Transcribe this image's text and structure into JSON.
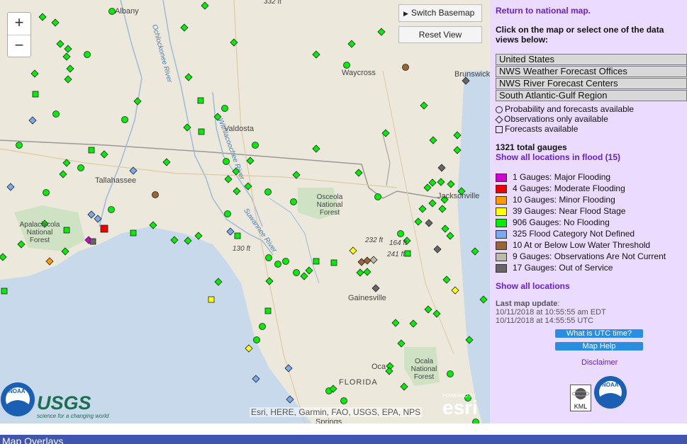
{
  "map": {
    "zoom_in": "+",
    "zoom_out": "−",
    "switch_basemap": "Switch Basemap",
    "reset_view": "Reset View",
    "place_labels": [
      "Albany",
      "Waycross",
      "Brunswick",
      "Valdosta",
      "Tallahassee",
      "Jacksonville",
      "Osceola National Forest",
      "Apalachicola National Forest",
      "Gainesville",
      "Ocala National Forest",
      "FLORIDA",
      "Springs",
      "Oca"
    ],
    "elevation_labels": [
      "332 ft",
      "232 ft",
      "164 ft",
      "241 ft",
      "130 ft"
    ],
    "river_labels": [
      "Ochlockonee River",
      "Withlacoochee River",
      "Suwannee River"
    ],
    "attribution": "Esri, HERE, Garmin, FAO, USGS, EPA, NPS",
    "logos": [
      "NOAA",
      "USGS",
      "science for a changing world",
      "POWERED BY",
      "esri"
    ]
  },
  "panel": {
    "return_link": "Return to national map.",
    "instructions": "Click on the map or select one of the data views below:",
    "views": [
      "United States",
      "NWS Weather Forecast Offices",
      "NWS River Forecast Centers",
      "South Atlantic-Gulf Region"
    ],
    "symbols": [
      {
        "shape": "circle",
        "label": "Probability and forecasts available"
      },
      {
        "shape": "diamond",
        "label": "Observations only available"
      },
      {
        "shape": "square",
        "label": "Forecasts available"
      }
    ],
    "total_gauges": "1321 total gauges",
    "show_flood_link": "Show all locations in flood (15)",
    "legend": [
      {
        "label": "1 Gauges: Major Flooding",
        "color": "#d400d4"
      },
      {
        "label": "4 Gauges: Moderate Flooding",
        "color": "#ee0000"
      },
      {
        "label": "10 Gauges: Minor Flooding",
        "color": "#ff9900"
      },
      {
        "label": "39 Gauges: Near Flood Stage",
        "color": "#ffff00"
      },
      {
        "label": "906 Gauges: No Flooding",
        "color": "#00ee00"
      },
      {
        "label": "325 Flood Category Not Defined",
        "color": "#77aaee"
      },
      {
        "label": "10 At or Below Low Water Threshold",
        "color": "#996633"
      },
      {
        "label": "9 Gauges: Observations Are Not Current",
        "color": "#bbbbaa"
      },
      {
        "label": "17 Gauges: Out of Service",
        "color": "#666666"
      }
    ],
    "show_all_link": "Show all locations",
    "last_update_label": "Last map update",
    "last_update_edt": "10/11/2018 at 10:55:55 am EDT",
    "last_update_utc": "10/11/2018 at 14:55:55 UTC",
    "utc_button": "What is UTC time?",
    "help_button": "Map Help",
    "disclaimer": "Disclaimer",
    "kml_label": "KML",
    "noaa_label": "NOAA"
  },
  "footer": {
    "overlays_title": "Map Overlays"
  }
}
